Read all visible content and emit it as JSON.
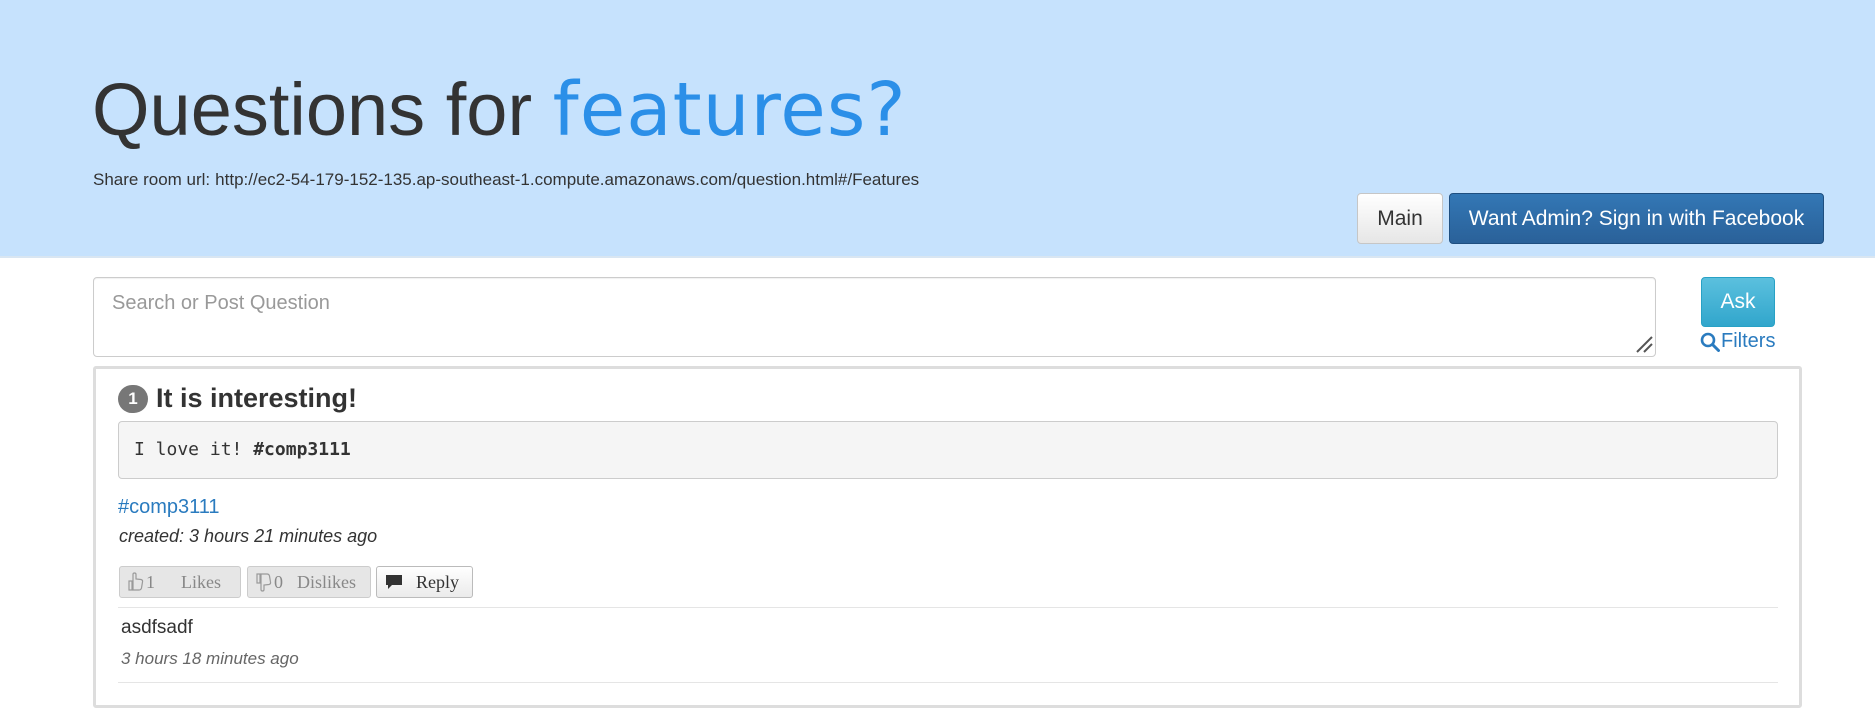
{
  "header": {
    "title_prefix": "Questions for",
    "room_name": "features?",
    "share_label": "Share room url:",
    "share_url": "http://ec2-54-179-152-135.ap-southeast-1.compute.amazonaws.com/question.html#/Features",
    "main_button": "Main",
    "admin_button": "Want Admin? Sign in with Facebook"
  },
  "search": {
    "placeholder": "Search or Post Question",
    "ask_button": "Ask",
    "filters_label": "Filters"
  },
  "questions": [
    {
      "number": "1",
      "title": "It is interesting!",
      "body_text": "I love it!",
      "body_tag": "#comp3111",
      "tag": "#comp3111",
      "created": "created: 3 hours 21 minutes ago",
      "likes_count": "1",
      "likes_label": "Likes",
      "dislikes_count": "0",
      "dislikes_label": "Dislikes",
      "reply_label": "Reply",
      "replies": [
        {
          "text": "asdfsadf",
          "time": "3 hours 18 minutes ago"
        }
      ]
    }
  ],
  "colors": {
    "header_bg": "#c6e2fd",
    "room_accent": "#2b8fe8",
    "facebook_button": "#2a6199",
    "ask_button": "#5bc0de",
    "link": "#2a7bbf"
  },
  "icons": {
    "filters": "search-icon",
    "likes": "thumbs-up-icon",
    "dislikes": "thumbs-down-icon",
    "reply": "comment-icon",
    "resize": "resize-handle-icon"
  }
}
